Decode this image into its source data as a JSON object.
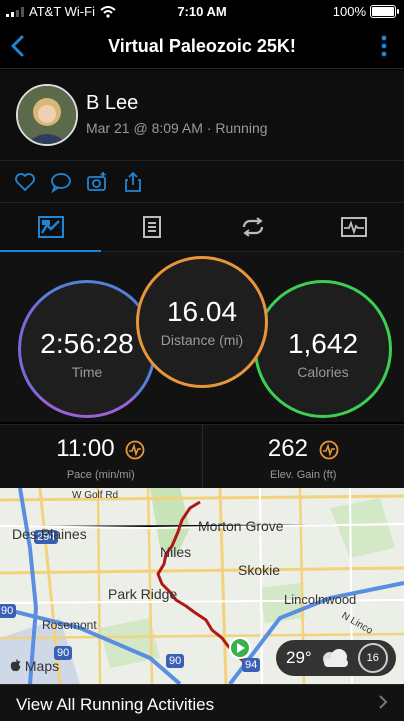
{
  "status": {
    "carrier": "AT&T Wi-Fi",
    "time": "7:10 AM",
    "battery": "100%"
  },
  "nav": {
    "title": "Virtual Paleozoic 25K!"
  },
  "profile": {
    "name": "B Lee",
    "meta": "Mar 21 @ 8:09 AM · Running"
  },
  "metrics": {
    "time": {
      "value": "2:56:28",
      "label": "Time"
    },
    "distance": {
      "value": "16.04",
      "label": "Distance (mi)"
    },
    "calories": {
      "value": "1,642",
      "label": "Calories"
    },
    "pace": {
      "value": "11:00",
      "label": "Pace (min/mi)"
    },
    "elev": {
      "value": "262",
      "label": "Elev. Gain (ft)"
    }
  },
  "map": {
    "labels": {
      "golf": "W Golf Rd",
      "des_plaines": "Des Plaines",
      "morton": "Morton Grove",
      "niles": "Niles",
      "skokie": "Skokie",
      "park_ridge": "Park Ridge",
      "lincolnwood": "Lincolnwood",
      "rosemont": "Rosemont",
      "n_linc": "N Linco",
      "r294": "294",
      "r90a": "90",
      "r90b": "90",
      "r90c": "90",
      "r94": "94"
    },
    "logo": "Maps",
    "weather": {
      "temp": "29°",
      "aqi": "16"
    }
  },
  "bottom": {
    "link": "View All Running Activities"
  },
  "colors": {
    "accent": "#1f86d6",
    "distance": "#e8963a",
    "calories": "#3ccf52",
    "time": "#5580d8",
    "route": "#b01818"
  }
}
